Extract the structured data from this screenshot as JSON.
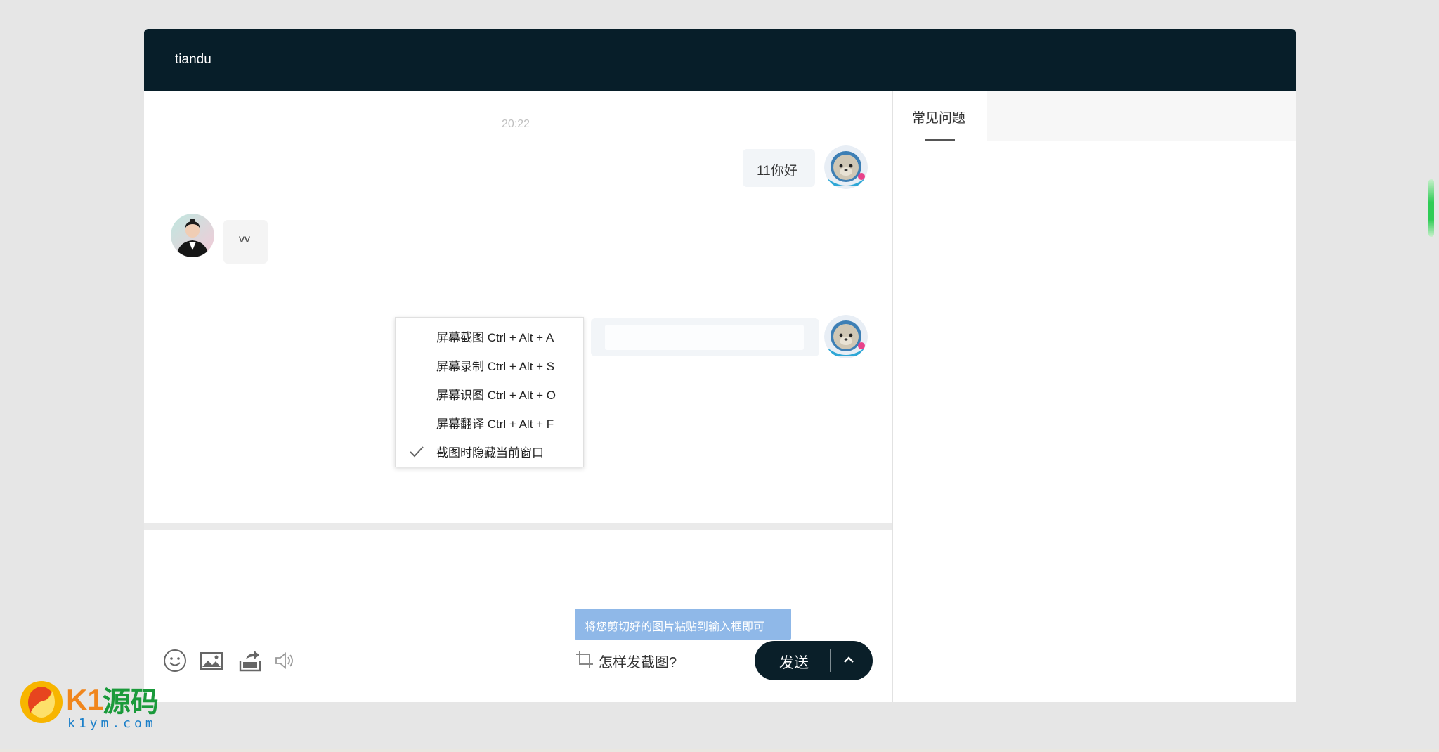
{
  "header": {
    "title": "tiandu"
  },
  "chat": {
    "timestamp": "20:22",
    "messages": [
      {
        "side": "right",
        "text": "11你好"
      },
      {
        "side": "left",
        "text": "vv"
      },
      {
        "side": "right",
        "text": ""
      }
    ]
  },
  "screenshot_menu": {
    "items": [
      {
        "label": "屏幕截图 Ctrl + Alt + A",
        "checked": false
      },
      {
        "label": "屏幕录制 Ctrl + Alt + S",
        "checked": false
      },
      {
        "label": "屏幕识图 Ctrl + Alt + O",
        "checked": false
      },
      {
        "label": "屏幕翻译 Ctrl + Alt + F",
        "checked": false
      },
      {
        "label": "截图时隐藏当前窗口",
        "checked": true
      }
    ]
  },
  "composer": {
    "tooltip": "将您剪切好的图片粘贴到输入框即可",
    "howto_label": "怎样发截图?",
    "send_label": "发送",
    "tools": [
      "emoji-icon",
      "image-icon",
      "file-upload-icon",
      "volume-icon"
    ]
  },
  "right_panel": {
    "tabs": [
      {
        "label": "常见问题",
        "active": true
      }
    ]
  },
  "watermark": {
    "brand": "K1源码",
    "domain": "k1ym.com"
  },
  "colors": {
    "header_bg": "#071e29",
    "send_bg": "#0a1f29",
    "tooltip_bg": "#8fb8e8",
    "accent_green": "#2ecc55"
  }
}
